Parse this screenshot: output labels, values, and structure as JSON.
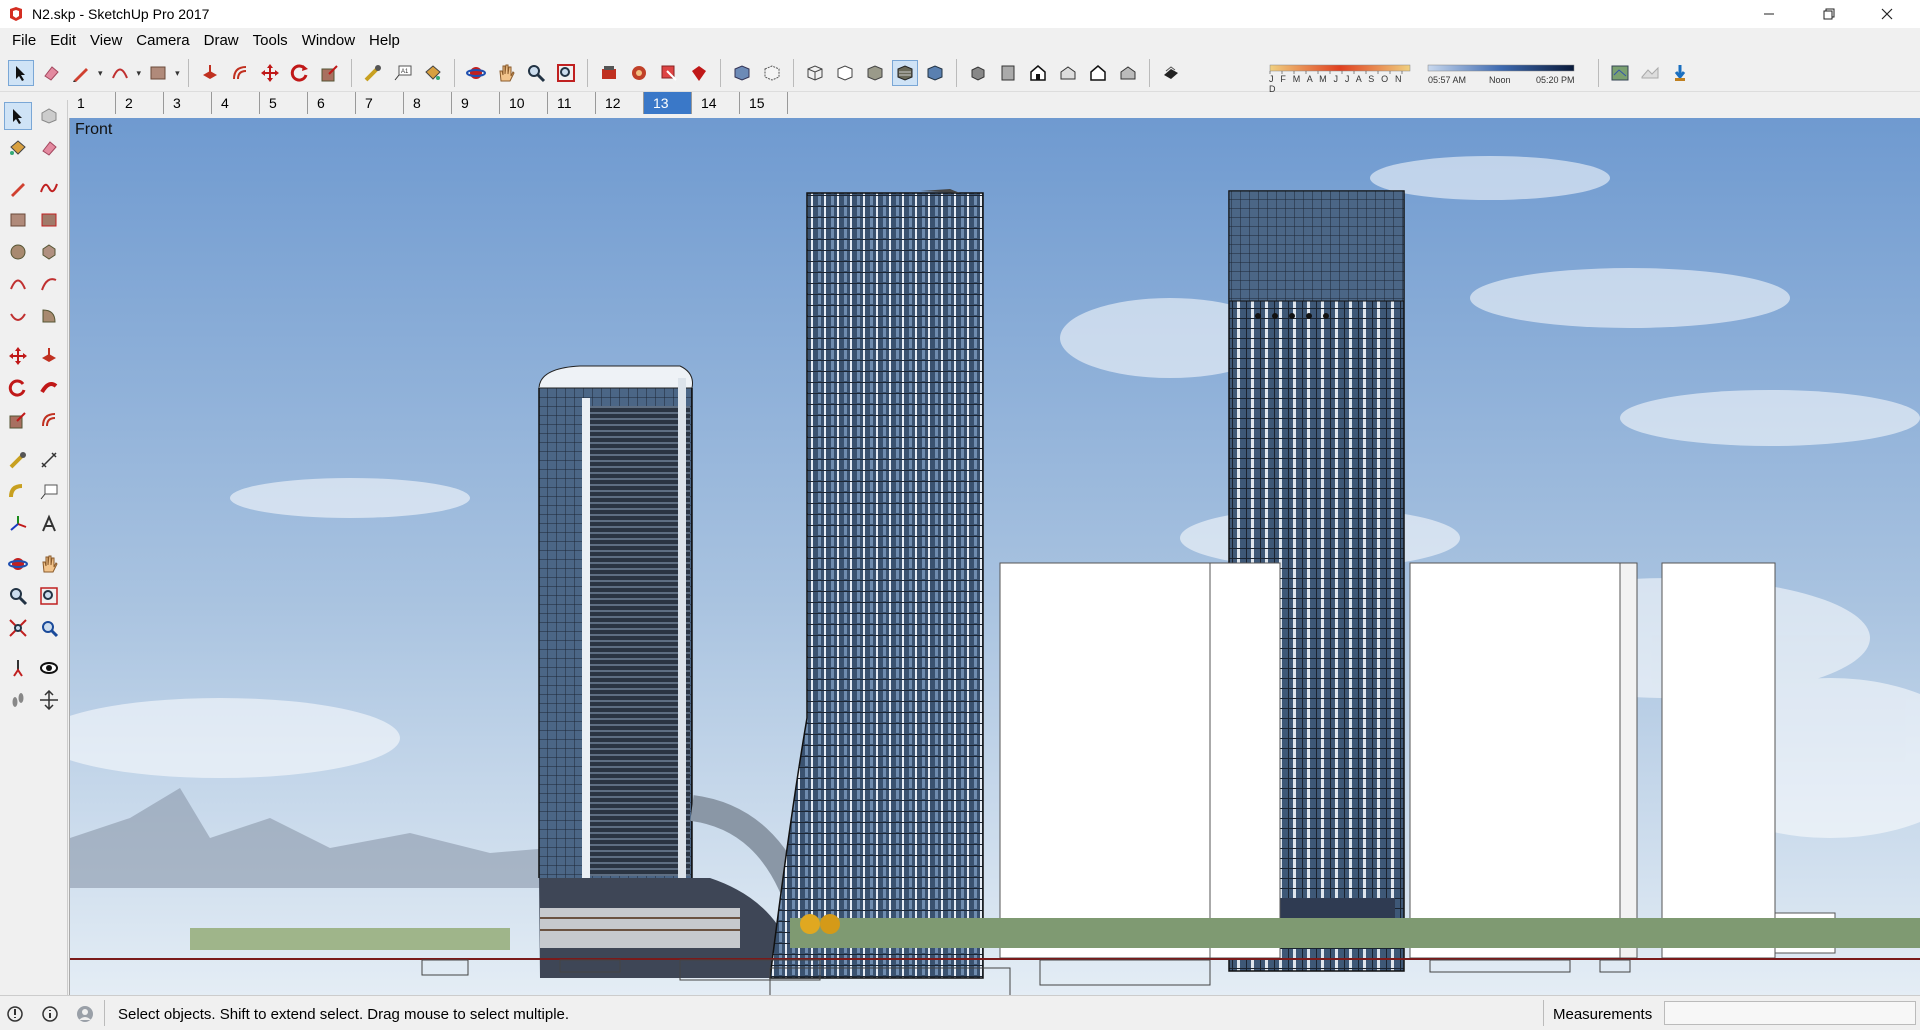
{
  "window": {
    "title": "N2.skp - SketchUp Pro 2017",
    "minimize_icon": "minimize-icon",
    "maximize_icon": "restore-icon",
    "close_icon": "close-icon"
  },
  "menu": {
    "items": [
      {
        "label": "File"
      },
      {
        "label": "Edit"
      },
      {
        "label": "View"
      },
      {
        "label": "Camera"
      },
      {
        "label": "Draw"
      },
      {
        "label": "Tools"
      },
      {
        "label": "Window"
      },
      {
        "label": "Help"
      }
    ]
  },
  "toolbar": {
    "shadow": {
      "months": "J F M A M J J A S O N D",
      "time_start": "05:57 AM",
      "time_mid": "Noon",
      "time_end": "05:20 PM"
    }
  },
  "scenes": {
    "tabs": [
      "1",
      "2",
      "3",
      "4",
      "5",
      "6",
      "7",
      "8",
      "9",
      "10",
      "11",
      "12",
      "13",
      "14",
      "15"
    ],
    "active": "13"
  },
  "viewport": {
    "view_label": "Front"
  },
  "status": {
    "message": "Select objects. Shift to extend select. Drag mouse to select multiple.",
    "measurements_label": "Measurements",
    "measurements_value": ""
  },
  "colors": {
    "accent": "#3a78c8",
    "sky_top": "#5d8fc7",
    "sky_bottom": "#dde8f2",
    "glass": "#3e5570"
  }
}
